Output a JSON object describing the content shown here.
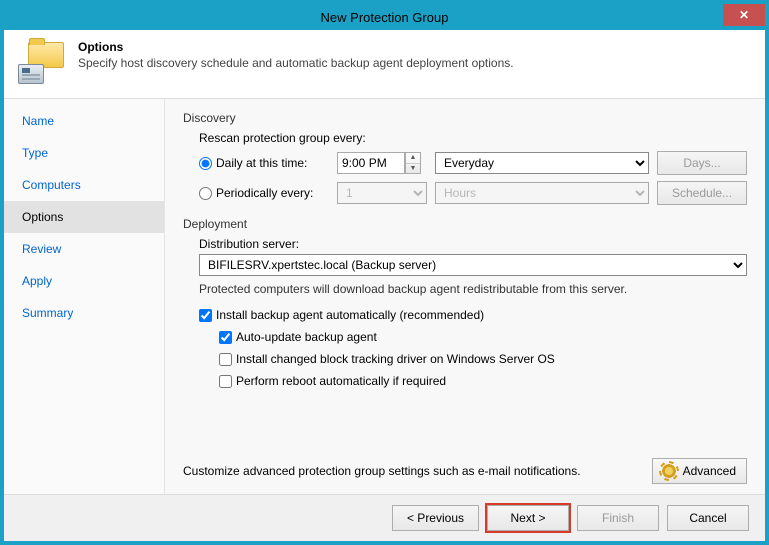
{
  "window": {
    "title": "New Protection Group"
  },
  "header": {
    "title": "Options",
    "desc": "Specify host discovery schedule and automatic backup agent deployment options."
  },
  "nav": {
    "items": [
      "Name",
      "Type",
      "Computers",
      "Options",
      "Review",
      "Apply",
      "Summary"
    ],
    "active": "Options"
  },
  "discovery": {
    "title": "Discovery",
    "rescan_label": "Rescan protection group every:",
    "daily_label": "Daily at this time:",
    "time_value": "9:00 PM",
    "day_select": "Everyday",
    "days_btn": "Days...",
    "periodic_label": "Periodically every:",
    "period_value": "1",
    "period_unit": "Hours",
    "schedule_btn": "Schedule..."
  },
  "deployment": {
    "title": "Deployment",
    "dist_label": "Distribution server:",
    "dist_value": "BIFILESRV.xpertstec.local (Backup server)",
    "note": "Protected computers will download backup agent redistributable from this server.",
    "install_label": "Install backup agent automatically (recommended)",
    "auto_update_label": "Auto-update backup agent",
    "cbt_label": "Install changed block tracking driver on Windows Server OS",
    "reboot_label": "Perform reboot automatically if required"
  },
  "advanced": {
    "note": "Customize advanced protection group settings such as e-mail notifications.",
    "btn": "Advanced"
  },
  "buttons": {
    "previous": "< Previous",
    "next": "Next >",
    "finish": "Finish",
    "cancel": "Cancel"
  }
}
